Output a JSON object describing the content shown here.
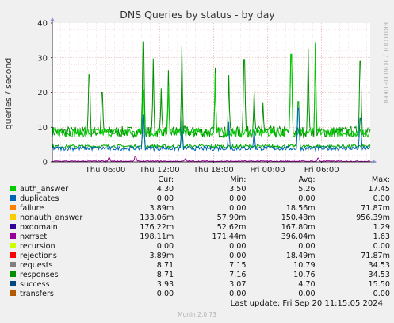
{
  "chart_data": {
    "type": "line",
    "title": "DNS Queries by status - by day",
    "ylabel": "queries / second",
    "ylim": [
      0,
      40
    ],
    "yticks": [
      "0",
      "10",
      "20",
      "30",
      "40"
    ],
    "xticks": [
      "Thu 06:00",
      "Thu 12:00",
      "Thu 18:00",
      "Fri 00:00",
      "Fri 06:00"
    ],
    "xtick_hours": [
      6,
      12,
      18,
      24,
      30
    ],
    "xlim_hours": [
      0.1,
      35.4
    ],
    "grid": true,
    "series": [
      {
        "name": "requests",
        "color": "#008f00",
        "baseline": 8.7,
        "noise": 1.6,
        "spikes": [
          [
            4.2,
            25.2
          ],
          [
            5.6,
            20.0
          ],
          [
            10.2,
            34.5
          ],
          [
            11.3,
            29.8
          ],
          [
            12.2,
            21.2
          ],
          [
            13.0,
            26.5
          ],
          [
            14.5,
            33.5
          ],
          [
            18.2,
            27.0
          ],
          [
            19.7,
            25.0
          ],
          [
            21.4,
            29.5
          ],
          [
            22.5,
            20.5
          ],
          [
            23.5,
            17.0
          ],
          [
            26.6,
            31.0
          ],
          [
            28.5,
            32.5
          ],
          [
            29.3,
            34.0
          ],
          [
            34.3,
            29.0
          ]
        ]
      },
      {
        "name": "responses",
        "color": "#00cc00",
        "baseline": 8.5,
        "noise": 1.3,
        "spikes": [
          [
            10.2,
            20.5
          ],
          [
            13.0,
            22.0
          ],
          [
            18.2,
            25.5
          ],
          [
            26.6,
            31.0
          ],
          [
            29.3,
            34.5
          ]
        ]
      },
      {
        "name": "success",
        "color": "#0066b3",
        "baseline": 3.9,
        "noise": 0.6,
        "spikes": [
          [
            10.2,
            13.5
          ],
          [
            14.5,
            12.0
          ],
          [
            19.7,
            11.5
          ],
          [
            22.5,
            10.0
          ],
          [
            27.4,
            15.5
          ],
          [
            34.3,
            12.5
          ]
        ]
      },
      {
        "name": "auth_answer",
        "color": "#00aa00",
        "baseline": 4.5,
        "noise": 0.5,
        "spikes": [
          [
            10.2,
            12.5
          ],
          [
            14.5,
            13.0
          ],
          [
            27.4,
            17.45
          ]
        ]
      },
      {
        "name": "nxrrset",
        "color": "#990099",
        "baseline": 0.2,
        "noise": 0.15,
        "spikes": [
          [
            6.4,
            1.2
          ],
          [
            9.3,
            1.63
          ],
          [
            14.9,
            0.9
          ],
          [
            29.6,
            1.1
          ]
        ]
      }
    ]
  },
  "legend": {
    "headers": {
      "cur": "Cur:",
      "min": "Min:",
      "avg": "Avg:",
      "max": "Max:"
    },
    "rows": [
      {
        "name": "auth_answer",
        "color": "#00cc00",
        "cur": "4.30",
        "min": "3.50",
        "avg": "5.26",
        "max": "17.45"
      },
      {
        "name": "duplicates",
        "color": "#0066b3",
        "cur": "0.00",
        "min": "0.00",
        "avg": "0.00",
        "max": "0.00"
      },
      {
        "name": "failure",
        "color": "#ff8000",
        "cur": "3.89m",
        "min": "0.00",
        "avg": "18.56m",
        "max": "71.87m"
      },
      {
        "name": "nonauth_answer",
        "color": "#ffcc00",
        "cur": "133.06m",
        "min": "57.90m",
        "avg": "150.48m",
        "max": "956.39m"
      },
      {
        "name": "nxdomain",
        "color": "#330099",
        "cur": "176.22m",
        "min": "52.62m",
        "avg": "167.80m",
        "max": "1.29"
      },
      {
        "name": "nxrrset",
        "color": "#990099",
        "cur": "198.11m",
        "min": "171.44m",
        "avg": "396.04m",
        "max": "1.63"
      },
      {
        "name": "recursion",
        "color": "#ccff00",
        "cur": "0.00",
        "min": "0.00",
        "avg": "0.00",
        "max": "0.00"
      },
      {
        "name": "rejections",
        "color": "#ff0000",
        "cur": "3.89m",
        "min": "0.00",
        "avg": "18.49m",
        "max": "71.87m"
      },
      {
        "name": "requests",
        "color": "#808080",
        "cur": "8.71",
        "min": "7.15",
        "avg": "10.79",
        "max": "34.53"
      },
      {
        "name": "responses",
        "color": "#008f00",
        "cur": "8.71",
        "min": "7.16",
        "avg": "10.76",
        "max": "34.53"
      },
      {
        "name": "success",
        "color": "#00487d",
        "cur": "3.93",
        "min": "3.07",
        "avg": "4.70",
        "max": "15.50"
      },
      {
        "name": "transfers",
        "color": "#b35a00",
        "cur": "0.00",
        "min": "0.00",
        "avg": "0.00",
        "max": "0.00"
      }
    ]
  },
  "footer": {
    "last_update": "Last update: Fri Sep 20 11:15:05 2024",
    "munin_version": "Munin 2.0.73",
    "vertical_label": "RRDTOOL / TOBI OETIKER"
  }
}
